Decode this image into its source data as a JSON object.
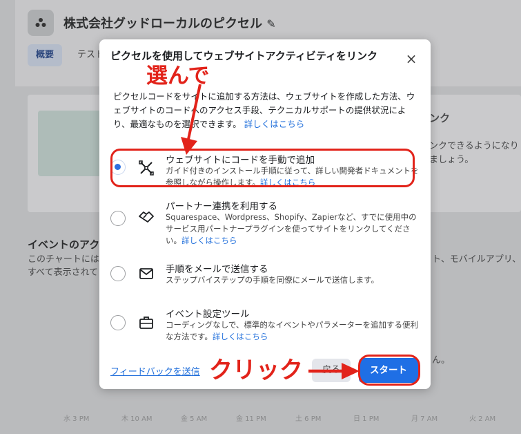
{
  "background": {
    "page_title": "株式会社グッドローカルのピクセル",
    "tabs": [
      "概要",
      "テスト"
    ],
    "card_text_1": "ンク",
    "card_text_2": "ンクできるようになり",
    "card_text_3": "ましょう。",
    "events_heading": "イベントのアク",
    "events_line_1": "このチャートには",
    "events_line_2": "すべて表示されて",
    "events_right": "ト、モバイルアプリ、",
    "events_right_2": "ん。",
    "axis_labels": [
      "水 3 PM",
      "木 10 AM",
      "金 5 AM",
      "金 11 PM",
      "土 6 PM",
      "日 1 PM",
      "月 7 AM",
      "火 2 AM"
    ]
  },
  "dialog": {
    "title": "ピクセルを使用してウェブサイトアクティビティをリンク",
    "close_label": "×",
    "description": "ピクセルコードをサイトに追加する方法は、ウェブサイトを作成した方法、ウェブサイトのコードへのアクセス手段、テクニカルサポートの提供状況により、最適なものを選択できます。",
    "description_link": "詳しくはこちら",
    "options": [
      {
        "title": "ウェブサイトにコードを手動で追加",
        "desc": "ガイド付きのインストール手順に従って、詳しい開発者ドキュメントを参照しながら操作します。",
        "link": "詳しくはこちら",
        "icon": "tools-icon",
        "selected": true
      },
      {
        "title": "パートナー連携を利用する",
        "desc": "Squarespace、Wordpress、Shopify、Zapierなど、すでに使用中のサービス用パートナープラグインを使ってサイトをリンクしてください。",
        "link": "詳しくはこちら",
        "icon": "handshake-icon",
        "selected": false
      },
      {
        "title": "手順をメールで送信する",
        "desc": "ステップバイステップの手順を同僚にメールで送信します。",
        "link": "",
        "icon": "mail-icon",
        "selected": false
      },
      {
        "title": "イベント設定ツール",
        "desc": "コーディングなしで、標準的なイベントやパラメーターを追加する便利な方法です。",
        "link": "詳しくはこちら",
        "icon": "briefcase-icon",
        "selected": false
      }
    ],
    "feedback_link": "フィードバックを送信",
    "back_button": "戻る",
    "start_button": "スタート"
  },
  "annotations": {
    "choose_label": "選んで",
    "click_label": "クリック",
    "color": "#e2231a"
  }
}
